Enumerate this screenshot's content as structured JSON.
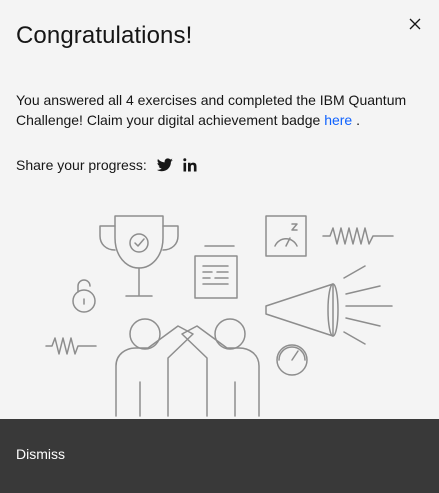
{
  "modal": {
    "title": "Congratulations!",
    "message_prefix": "You answered all 4 exercises and completed the IBM Quantum Challenge! Claim your digital achievement badge ",
    "badge_link_text": "here",
    "message_suffix": " .",
    "share_label": "Share your progress:",
    "share_icons": [
      "twitter-icon",
      "linkedin-icon"
    ],
    "close_icon": "close-icon",
    "dismiss_label": "Dismiss"
  },
  "colors": {
    "background": "#f4f4f4",
    "text": "#161616",
    "link": "#0f62fe",
    "footer": "#393939",
    "footer_text": "#ffffff",
    "illustration_stroke": "#8d8d8d"
  }
}
